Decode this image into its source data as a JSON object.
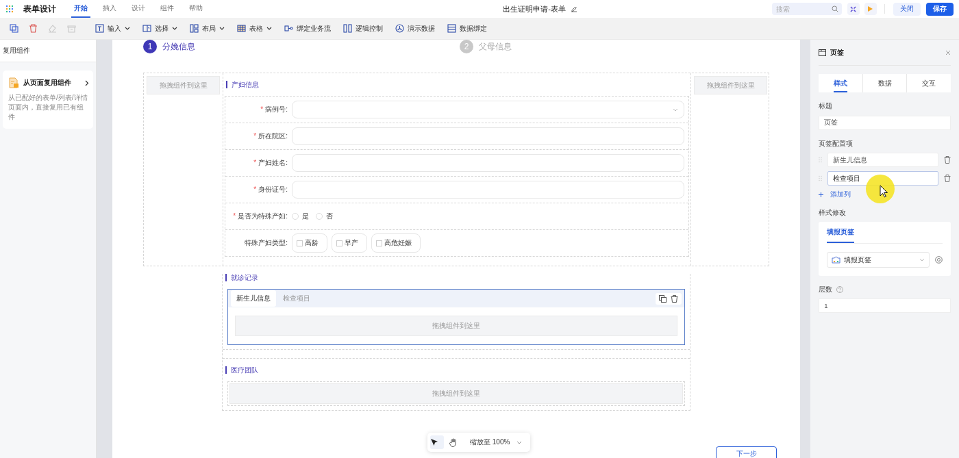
{
  "app": {
    "title": "表单设计"
  },
  "menu": [
    {
      "label": "开始",
      "selected": true
    },
    {
      "label": "插入",
      "selected": false
    },
    {
      "label": "设计",
      "selected": false
    },
    {
      "label": "组件",
      "selected": false
    },
    {
      "label": "帮助",
      "selected": false
    }
  ],
  "document_title": "出生证明申请-表单",
  "search": {
    "placeholder": "搜索"
  },
  "header_buttons": [
    {
      "label": "关闭",
      "kind": "secondary"
    },
    {
      "label": "保存",
      "kind": "primary"
    }
  ],
  "toolbar": [
    {
      "kind": "icon",
      "disabled": false
    },
    {
      "kind": "icon",
      "disabled": false
    },
    {
      "kind": "icon",
      "disabled": true
    },
    {
      "kind": "icon",
      "disabled": true
    },
    {
      "kind": "menu",
      "label": "输入"
    },
    {
      "kind": "menu",
      "label": "选择"
    },
    {
      "kind": "menu",
      "label": "布局"
    },
    {
      "kind": "menu",
      "label": "表格"
    },
    {
      "kind": "action",
      "label": "绑定业务流"
    },
    {
      "kind": "action",
      "label": "逻辑控制"
    },
    {
      "kind": "action",
      "label": "演示数据"
    },
    {
      "kind": "action",
      "label": "数据绑定"
    }
  ],
  "sidebar": {
    "title": "复用组件",
    "card": {
      "title": "从页面复用组件",
      "description": "从已配好的表单/列表/详情页面内，直接复用已有组件"
    }
  },
  "steps": [
    {
      "number": "1",
      "label": "分娩信息",
      "selected": true
    },
    {
      "number": "2",
      "label": "父母信息",
      "selected": false
    }
  ],
  "drop_hint_left": "拖拽组件到这里",
  "drop_hint_right": "拖拽组件到这里",
  "mother_section": {
    "title": "产妇信息",
    "fields": [
      {
        "kind": "select",
        "label": "病例号:",
        "required_mark": "*"
      },
      {
        "kind": "input",
        "label": "所在院区:",
        "required_mark": "*"
      },
      {
        "kind": "input",
        "label": "产妇姓名:",
        "required_mark": "*"
      },
      {
        "kind": "input",
        "label": "身份证号:",
        "required_mark": "*"
      },
      {
        "kind": "radio",
        "label": "是否为特殊产妇:",
        "required_mark": "*",
        "options": [
          {
            "label": "是",
            "selected": false
          },
          {
            "label": "否",
            "selected": false
          }
        ]
      },
      {
        "kind": "checkbox",
        "label": "特殊产妇类型:",
        "options": [
          {
            "label": "高龄",
            "checked": false
          },
          {
            "label": "早产",
            "checked": false
          },
          {
            "label": "高危妊娠",
            "checked": false
          }
        ]
      }
    ]
  },
  "visit_section": {
    "title": "就诊记录",
    "tabs": [
      {
        "label": "新生儿信息",
        "selected": true
      },
      {
        "label": "检查项目",
        "selected": false
      }
    ],
    "drop_hint": "拖拽组件到这里"
  },
  "team_section": {
    "title": "医疗团队",
    "drop_hint": "拖拽组件到这里"
  },
  "zoom_bar": {
    "label": "缩放至 100%"
  },
  "next_button": "下一步",
  "properties": {
    "title": "页签",
    "tabs": [
      {
        "label": "样式",
        "selected": true
      },
      {
        "label": "数据",
        "selected": false
      },
      {
        "label": "交互",
        "selected": false
      }
    ],
    "title_label": "标题",
    "title_value": "页签",
    "items_label": "页签配置项",
    "items": [
      {
        "value": "新生儿信息",
        "focused": false
      },
      {
        "value": "检查项目",
        "focused": true
      }
    ],
    "add_label": "添加列",
    "style_label": "样式修改",
    "style_tab": "填报页签",
    "style_value": "填报页签",
    "levels_label": "层数",
    "levels_value": "1"
  }
}
